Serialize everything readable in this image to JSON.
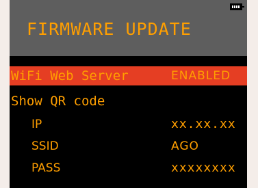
{
  "screen": {
    "title": "FIRMWARE UPDATE",
    "battery_icon": "battery-full-icon"
  },
  "menu": {
    "wifi_label": "WiFi Web Server",
    "wifi_value": "ENABLED",
    "qr_label": "Show QR code",
    "ip_label": "IP",
    "ip_value": "xx.xx.xx",
    "ssid_label": "SSID",
    "ssid_value": "AGO",
    "pass_label": "PASS",
    "pass_value": "xxxxxxxx"
  },
  "colors": {
    "text": "#ff9f00",
    "highlight": "#e53e23",
    "header": "#5e5e5e",
    "screen": "#000000",
    "outer": "#f4ede9"
  }
}
